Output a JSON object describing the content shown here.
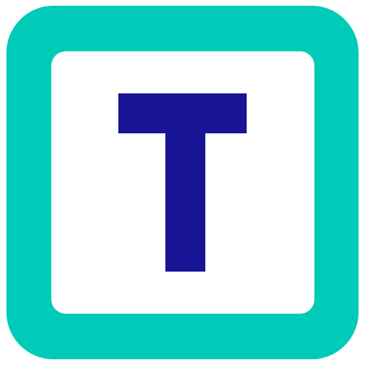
{
  "icon": {
    "letter": "T",
    "frame_color": "#00CBB8",
    "inner_color": "#FFFFFF",
    "letter_color": "#181496",
    "background_color": "#FFFFFF",
    "icon_name": "letter-t-icon"
  }
}
